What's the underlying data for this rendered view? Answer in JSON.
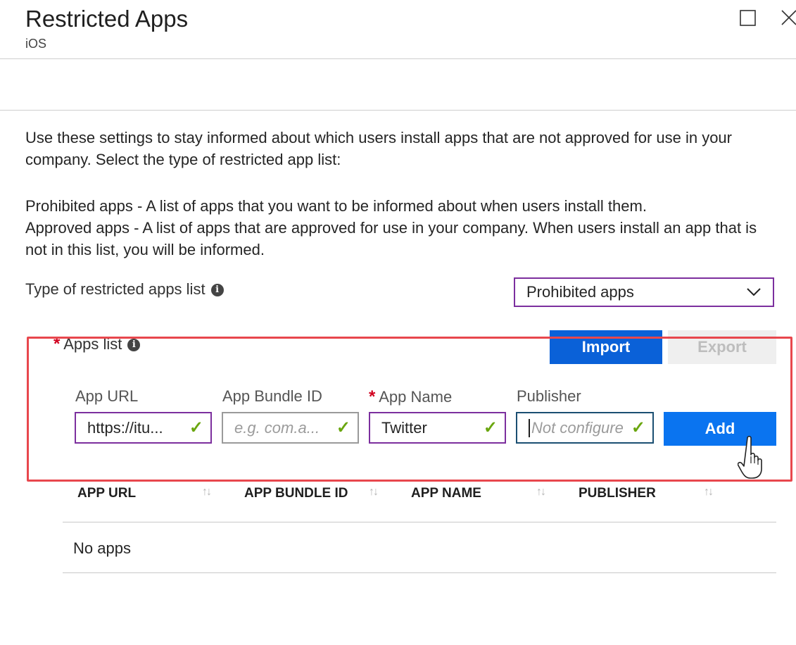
{
  "header": {
    "title": "Restricted Apps",
    "subtitle": "iOS"
  },
  "description": {
    "intro": "Use these settings to stay informed about which users install apps that are not approved for use in your company. Select the type of restricted app list:",
    "prohibited": "Prohibited apps - A list of apps that you want to be informed about when users install them.",
    "approved": "Approved apps - A list of apps that are approved for use in your company. When users install an app that is not in this list, you will be informed."
  },
  "list_type": {
    "label": "Type of restricted apps list",
    "selected": "Prohibited apps"
  },
  "apps_list": {
    "required_mark": "*",
    "label": "Apps list",
    "import_label": "Import",
    "export_label": "Export"
  },
  "form": {
    "app_url": {
      "label": "App URL",
      "value": "https://itu..."
    },
    "bundle_id": {
      "label": "App Bundle ID",
      "placeholder": "e.g. com.a..."
    },
    "app_name": {
      "label": "App Name",
      "value": "Twitter"
    },
    "publisher": {
      "label": "Publisher",
      "placeholder": "Not configure"
    },
    "add_label": "Add"
  },
  "table": {
    "columns": [
      "APP URL",
      "APP BUNDLE ID",
      "APP NAME",
      "PUBLISHER"
    ],
    "sort_glyph": "↑↓",
    "empty_text": "No apps"
  },
  "colors": {
    "accent_purple": "#7c2f9e",
    "primary_blue": "#0a61d8",
    "add_blue": "#0a74f0",
    "highlight_red": "#e8474d",
    "valid_green": "#6aa60f",
    "required_red": "#d1001f"
  },
  "icons": [
    "maximize-icon",
    "close-icon",
    "info-icon",
    "chevron-down-icon",
    "check-icon",
    "sort-icon",
    "hand-cursor-icon"
  ]
}
